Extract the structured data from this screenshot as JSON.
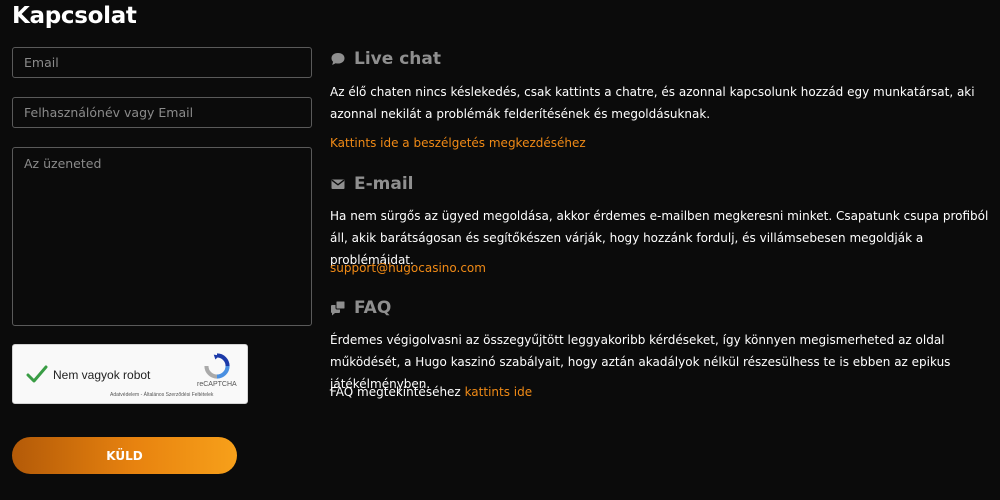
{
  "page": {
    "title": "Kapcsolat"
  },
  "form": {
    "email_placeholder": "Email",
    "username_placeholder": "Felhasználónév vagy Email",
    "message_placeholder": "Az üzeneted",
    "submit_label": "KÜLD"
  },
  "captcha": {
    "label": "Nem vagyok robot",
    "brand": "reCAPTCHA",
    "links": "Adatvédelem - Általános Szerződési Feltételek",
    "checked": true
  },
  "sections": {
    "live_chat": {
      "icon": "chat-bubble-icon",
      "heading": "Live chat",
      "text": "Az élő chaten nincs késlekedés, csak kattints a chatre, és azonnal kapcsolunk hozzád egy munkatársat, aki azonnal nekilát a problémák felderítésének és megoldásuknak.",
      "link": "Kattints ide a beszélgetés megkezdéséhez"
    },
    "email": {
      "icon": "envelope-icon",
      "heading": "E-mail",
      "text": "Ha nem sürgős az ügyed megoldása, akkor érdemes e-mailben megkeresni minket. Csapatunk csupa profiból áll, akik barátságosan és segítőkészen várják, hogy hozzánk fordulj, és villámsebesen megoldják a problémáidat.",
      "link": "support@hugocasino.com"
    },
    "faq": {
      "icon": "faq-chat-icon",
      "heading": "FAQ",
      "text": "Érdemes végigolvasni az összegyűjtött leggyakoribb kérdéseket, így könnyen megismerheted az oldal működését, a Hugo kaszinó szabályait, hogy aztán akadályok nélkül részesülhess te is ebben az epikus játékélményben.",
      "prefix": "FAQ megtekintéséhez",
      "link": "kattints ide"
    }
  },
  "colors": {
    "background": "#0b0b0b",
    "accent": "#f08a16",
    "heading_gray": "#8f8f8f",
    "checkmark": "#3a9d45"
  }
}
